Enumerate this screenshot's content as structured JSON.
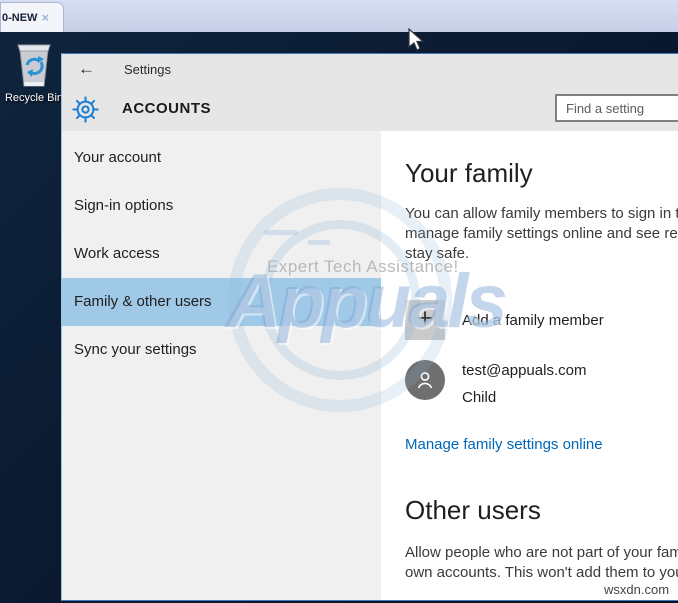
{
  "browser": {
    "tab_title": "0-NEW",
    "close_glyph": "×"
  },
  "desktop": {
    "recycle_bin_label": "Recycle Bin"
  },
  "window": {
    "back_glyph": "←",
    "title": "Settings",
    "page_title": "ACCOUNTS",
    "search_placeholder": "Find a setting",
    "sidebar": {
      "items": [
        {
          "label": "Your account"
        },
        {
          "label": "Sign-in options"
        },
        {
          "label": "Work access"
        },
        {
          "label": "Family & other users"
        },
        {
          "label": "Sync your settings"
        }
      ],
      "selected": "Family & other users"
    },
    "content": {
      "family": {
        "title": "Your family",
        "desc_lines": [
          "You can allow family members to sign in to",
          "manage family settings online and see rec",
          "stay safe."
        ],
        "add_glyph": "+",
        "add_label": "Add a family member",
        "member": {
          "email": "test@appuals.com",
          "role": "Child"
        },
        "manage_link": "Manage family settings online"
      },
      "other": {
        "title": "Other users",
        "desc_lines": [
          "Allow people who are not part of your fam",
          "own accounts. This won't add them to you"
        ]
      }
    }
  },
  "watermarks": {
    "expert": "Expert Tech Assistance!",
    "brand": "Appuals",
    "site": "wsxdn.com"
  },
  "colors": {
    "accent_blue": "#1d7dd2",
    "selected_item_bg": "#a0c8e7",
    "link_blue": "#0067b8",
    "window_border_blue": "#3c76b4",
    "header_bg": "#e6e6e6",
    "sidebar_bg": "#f0f0f1"
  }
}
